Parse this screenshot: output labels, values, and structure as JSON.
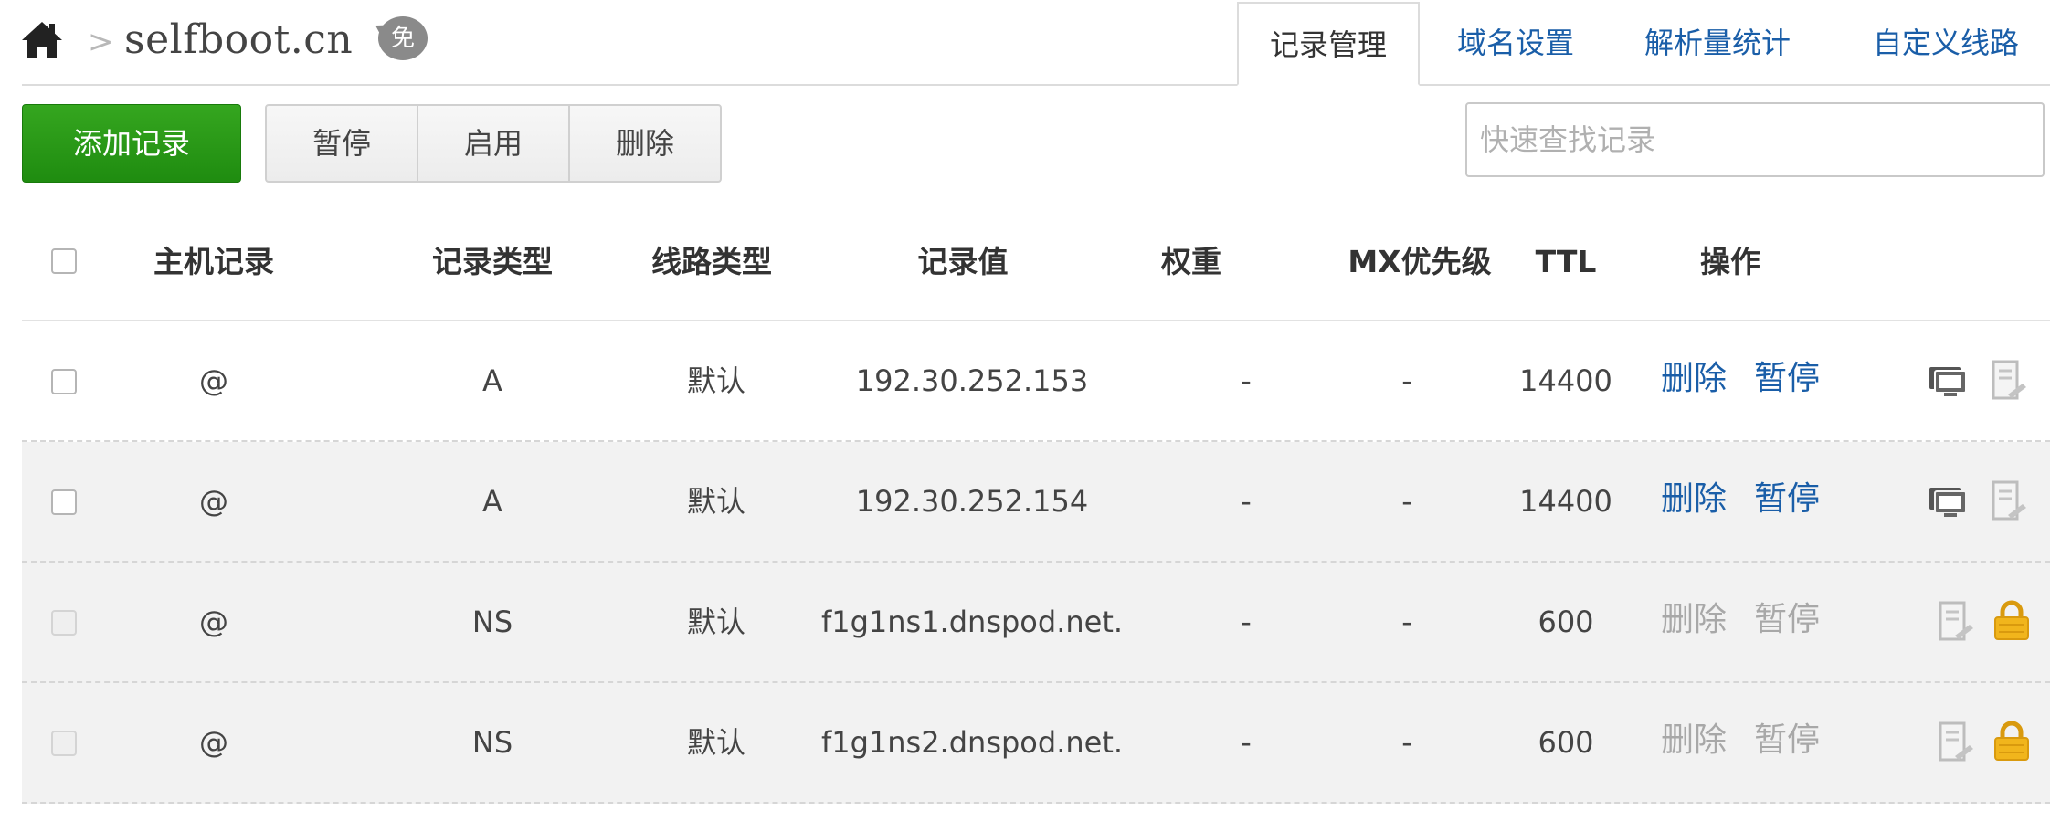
{
  "header": {
    "separator": ">",
    "domain": "selfboot.cn",
    "badge": "免",
    "tabs": [
      {
        "label": "记录管理",
        "active": true
      },
      {
        "label": "域名设置",
        "active": false
      },
      {
        "label": "解析量统计",
        "active": false
      },
      {
        "label": "自定义线路",
        "active": false
      }
    ]
  },
  "toolbar": {
    "add_label": "添加记录",
    "pause_label": "暂停",
    "enable_label": "启用",
    "delete_label": "删除",
    "search_placeholder": "快速查找记录"
  },
  "table": {
    "columns": [
      "主机记录",
      "记录类型",
      "线路类型",
      "记录值",
      "权重",
      "MX优先级",
      "TTL",
      "操作"
    ],
    "rows": [
      {
        "host": "@",
        "type": "A",
        "line": "默认",
        "value": "192.30.252.153",
        "weight": "-",
        "mx": "-",
        "ttl": "14400",
        "delete": "删除",
        "pause": "暂停",
        "locked": false,
        "icons": [
          "monitor-icon",
          "note-icon"
        ]
      },
      {
        "host": "@",
        "type": "A",
        "line": "默认",
        "value": "192.30.252.154",
        "weight": "-",
        "mx": "-",
        "ttl": "14400",
        "delete": "删除",
        "pause": "暂停",
        "locked": false,
        "icons": [
          "monitor-icon",
          "note-icon"
        ]
      },
      {
        "host": "@",
        "type": "NS",
        "line": "默认",
        "value": "f1g1ns1.dnspod.net.",
        "weight": "-",
        "mx": "-",
        "ttl": "600",
        "delete": "删除",
        "pause": "暂停",
        "locked": true,
        "icons": [
          "note-icon",
          "lock-icon"
        ]
      },
      {
        "host": "@",
        "type": "NS",
        "line": "默认",
        "value": "f1g1ns2.dnspod.net.",
        "weight": "-",
        "mx": "-",
        "ttl": "600",
        "delete": "删除",
        "pause": "暂停",
        "locked": true,
        "icons": [
          "note-icon",
          "lock-icon"
        ]
      }
    ]
  },
  "colors": {
    "accent": "#1a5ea8",
    "primary_button": "#2a9a18",
    "disabled_text": "#a8a8a8",
    "lock": "#f1b51c"
  }
}
